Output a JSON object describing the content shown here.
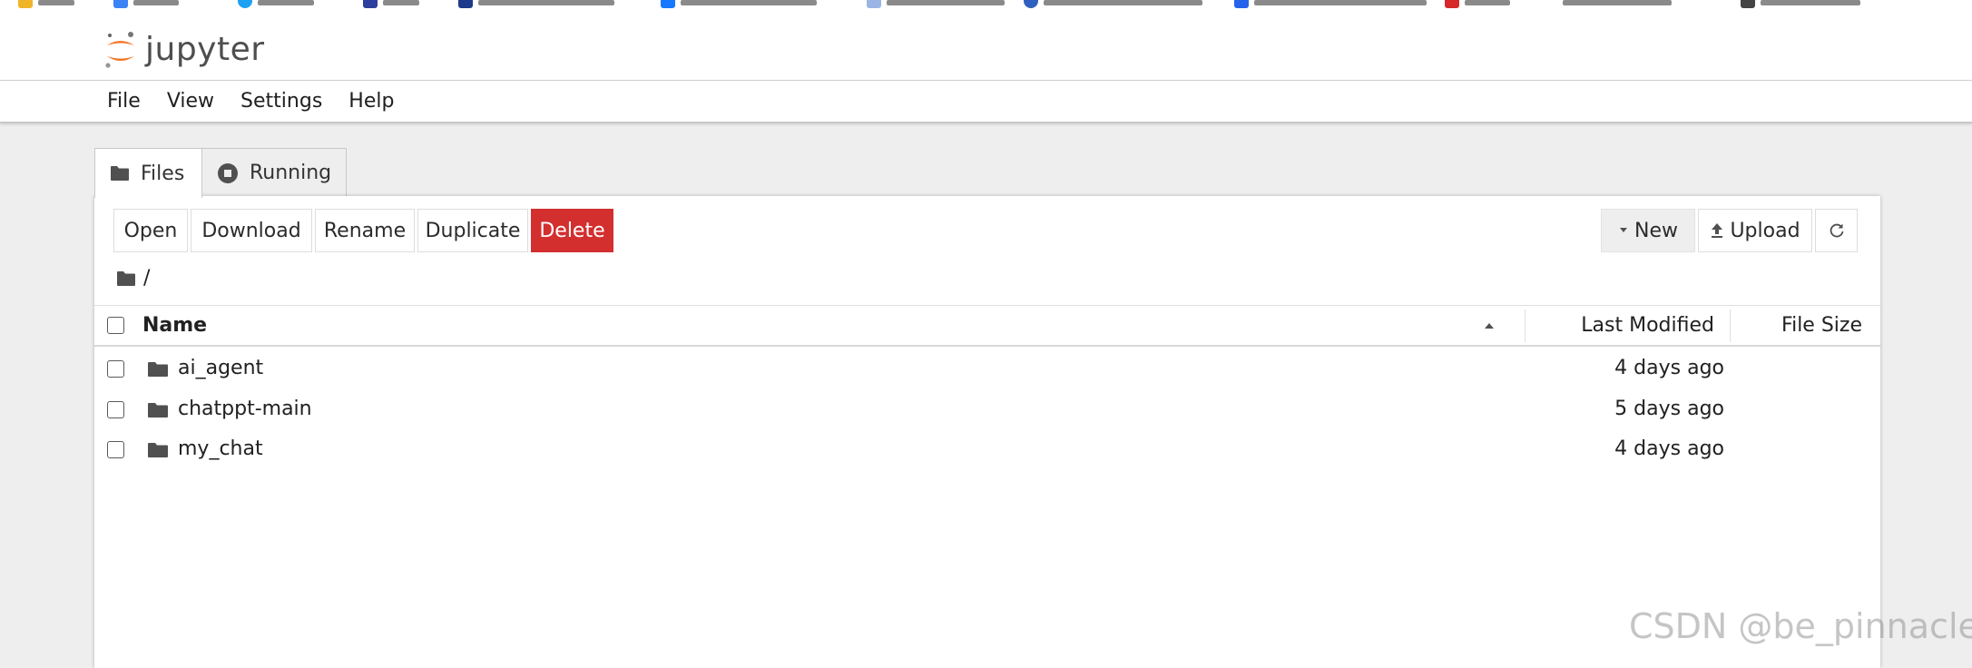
{
  "header": {
    "logo_text": "jupyter"
  },
  "menu": {
    "items": [
      "File",
      "View",
      "Settings",
      "Help"
    ]
  },
  "tabs": [
    {
      "label": "Files",
      "icon": "folder-icon",
      "active": true
    },
    {
      "label": "Running",
      "icon": "stop-circle-icon",
      "active": false
    }
  ],
  "toolbar": {
    "open_label": "Open",
    "download_label": "Download",
    "rename_label": "Rename",
    "duplicate_label": "Duplicate",
    "delete_label": "Delete",
    "new_label": "New",
    "upload_label": "Upload",
    "refresh_icon": "refresh-icon"
  },
  "breadcrumb": {
    "path": "/"
  },
  "listing": {
    "columns": {
      "name": "Name",
      "last_modified": "Last Modified",
      "file_size": "File Size"
    },
    "rows": [
      {
        "name": "ai_agent",
        "modified": "4 days ago",
        "type": "folder"
      },
      {
        "name": "chatppt-main",
        "modified": "5 days ago",
        "type": "folder"
      },
      {
        "name": "my_chat",
        "modified": "4 days ago",
        "type": "folder"
      }
    ]
  },
  "watermark": "CSDN @be_pinnacle",
  "colors": {
    "danger": "#d32f2f",
    "logo_orange": "#f37726",
    "background": "#eeeeee"
  }
}
